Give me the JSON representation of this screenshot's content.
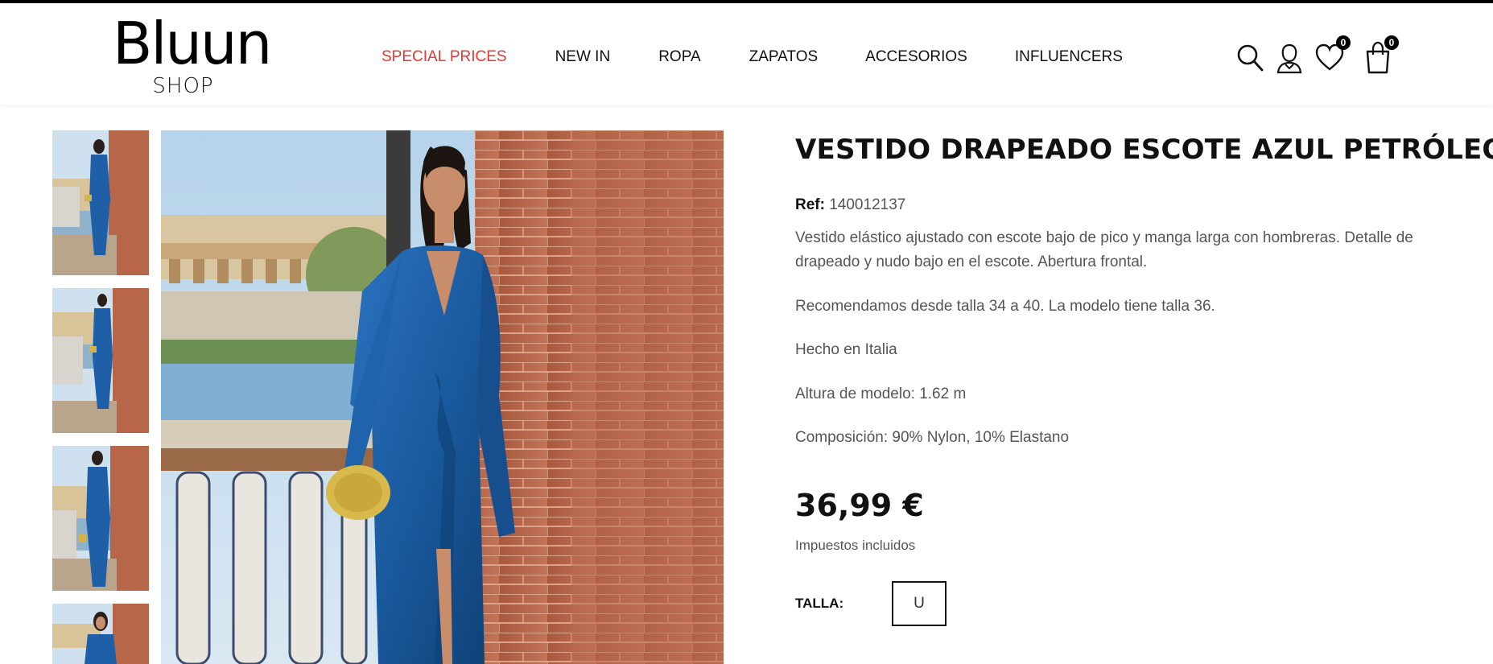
{
  "brand": {
    "name": "Bluun",
    "sub": "SHOP"
  },
  "nav": {
    "items": [
      {
        "label": "SPECIAL PRICES",
        "special": true
      },
      {
        "label": "NEW IN"
      },
      {
        "label": "ROPA"
      },
      {
        "label": "ZAPATOS"
      },
      {
        "label": "ACCESORIOS"
      },
      {
        "label": "INFLUENCERS"
      }
    ]
  },
  "header_icons": {
    "search": "search-icon",
    "account": "user-icon",
    "wishlist": "heart-icon",
    "wishlist_count": "0",
    "cart": "shopping-bag-icon",
    "cart_count": "0"
  },
  "product": {
    "title": "VESTIDO DRAPEADO ESCOTE AZUL PETRÓLEO",
    "ref_label": "Ref:",
    "ref_value": "140012137",
    "description": "Vestido elástico ajustado con escote bajo de pico y manga larga con hombreras. Detalle de drapeado y nudo bajo en el escote. Abertura frontal.",
    "size_note": "Recomendamos desde talla 34 a 40. La modelo tiene talla 36.",
    "made_in": "Hecho en Italia",
    "model_height": "Altura de modelo: 1.62 m",
    "composition": "Composición: 90% Nylon, 10% Elastano",
    "price": "36,99 €",
    "tax_note": "Impuestos incluidos",
    "size_label": "TALLA:",
    "sizes": [
      "U"
    ]
  },
  "colors": {
    "accent": "#e53935",
    "dress": "#1e5fa8",
    "brick": "#b8664a"
  }
}
